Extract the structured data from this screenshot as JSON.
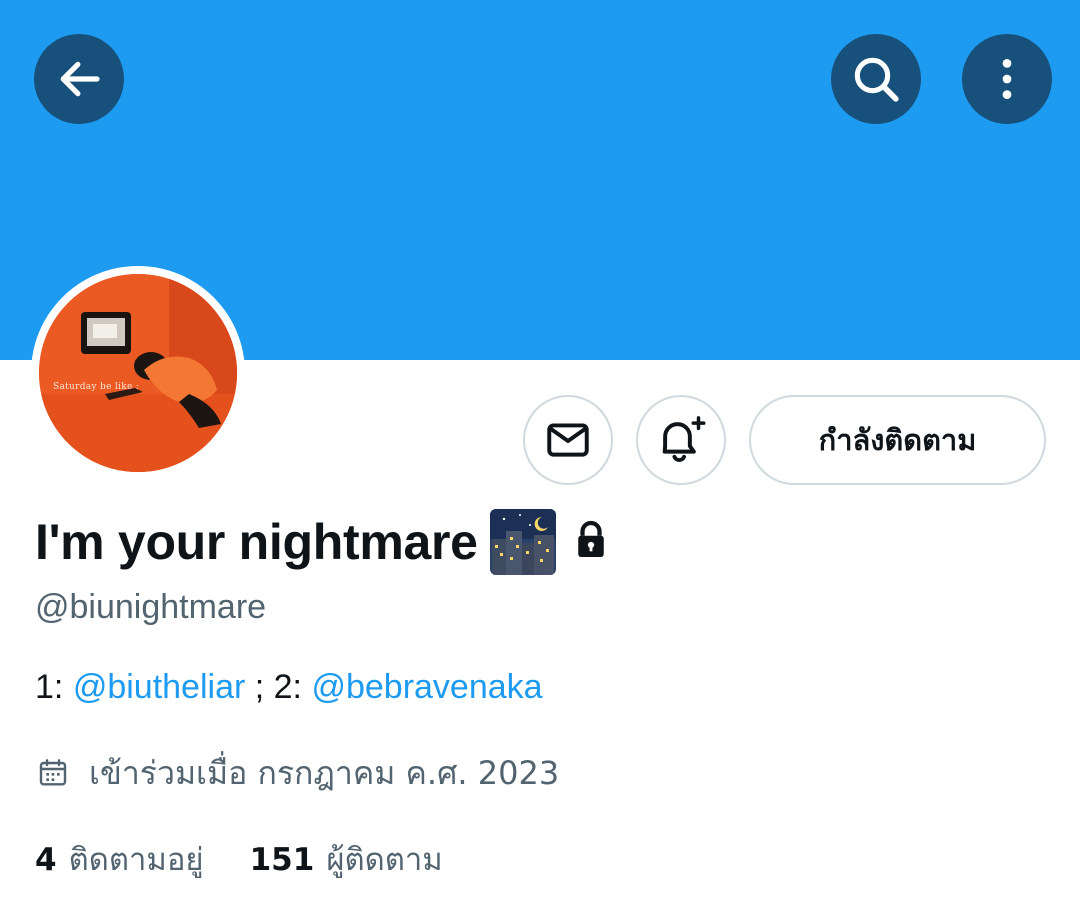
{
  "header": {
    "back_icon": "arrow-left-icon",
    "search_icon": "search-icon",
    "more_icon": "more-vertical-icon",
    "banner_color": "#1d9bf0",
    "button_color": "#17507a"
  },
  "profile": {
    "avatar_caption": "Saturday be like :",
    "display_name": "I'm your nightmare",
    "name_emoji": "night-city-emoji",
    "protected_icon": "lock-icon",
    "handle": "@biunightmare",
    "bio": {
      "prefix_1": "1: ",
      "mention_1": "@biutheliar",
      "separator": " ; 2: ",
      "mention_2": "@bebravenaka"
    },
    "joined": {
      "icon": "calendar-icon",
      "text": "เข้าร่วมเมื่อ กรกฎาคม ค.ศ. 2023"
    },
    "stats": {
      "following_count": "4",
      "following_label": "ติดตามอยู่",
      "followers_count": "151",
      "followers_label": "ผู้ติดตาม"
    }
  },
  "actions": {
    "message_icon": "envelope-icon",
    "notify_icon": "bell-plus-icon",
    "following_label": "กำลังติดตาม"
  }
}
